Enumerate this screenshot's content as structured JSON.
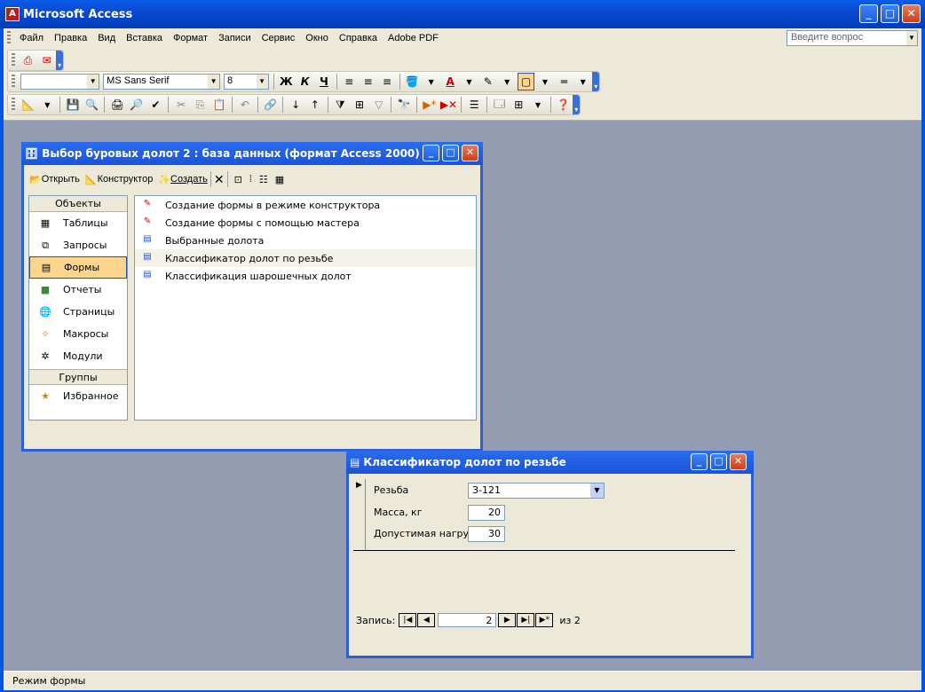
{
  "app": {
    "title": "Microsoft Access",
    "icon_label": "A"
  },
  "menus": [
    "Файл",
    "Правка",
    "Вид",
    "Вставка",
    "Формат",
    "Записи",
    "Сервис",
    "Окно",
    "Справка",
    "Adobe PDF"
  ],
  "ask_placeholder": "Введите вопрос",
  "format_toolbar": {
    "object_combo": "",
    "font": "MS Sans Serif",
    "size": "8",
    "bold": "Ж",
    "italic": "К",
    "underline": "Ч"
  },
  "db_window": {
    "title": "Выбор буровых долот 2 : база данных (формат Access 2000)",
    "toolbar": {
      "open": "Открыть",
      "design": "Конструктор",
      "create": "Создать"
    },
    "objects_header": "Объекты",
    "objects": [
      "Таблицы",
      "Запросы",
      "Формы",
      "Отчеты",
      "Страницы",
      "Макросы",
      "Модули"
    ],
    "groups_header": "Группы",
    "groups": [
      "Избранное"
    ],
    "items": [
      "Создание формы в режиме конструктора",
      "Создание формы с помощью мастера",
      "Выбранные долота",
      "Классификатор долот по резьбе",
      "Классификация шарошечных долот"
    ]
  },
  "form_window": {
    "title": "Классификатор долот по резьбе",
    "fields": [
      {
        "label": "Резьба",
        "value": "З-121"
      },
      {
        "label": "Масса, кг",
        "value": "20"
      },
      {
        "label": "Допустимая нагруз",
        "value": "30"
      }
    ],
    "nav": {
      "label": "Запись:",
      "current": "2",
      "of_label": "из 2"
    }
  },
  "status": "Режим формы",
  "colors": {
    "xp_blue": "#0054e3",
    "mdi_bg": "#939cb1",
    "chrome": "#ece9d8",
    "selected": "#fcd68e"
  }
}
